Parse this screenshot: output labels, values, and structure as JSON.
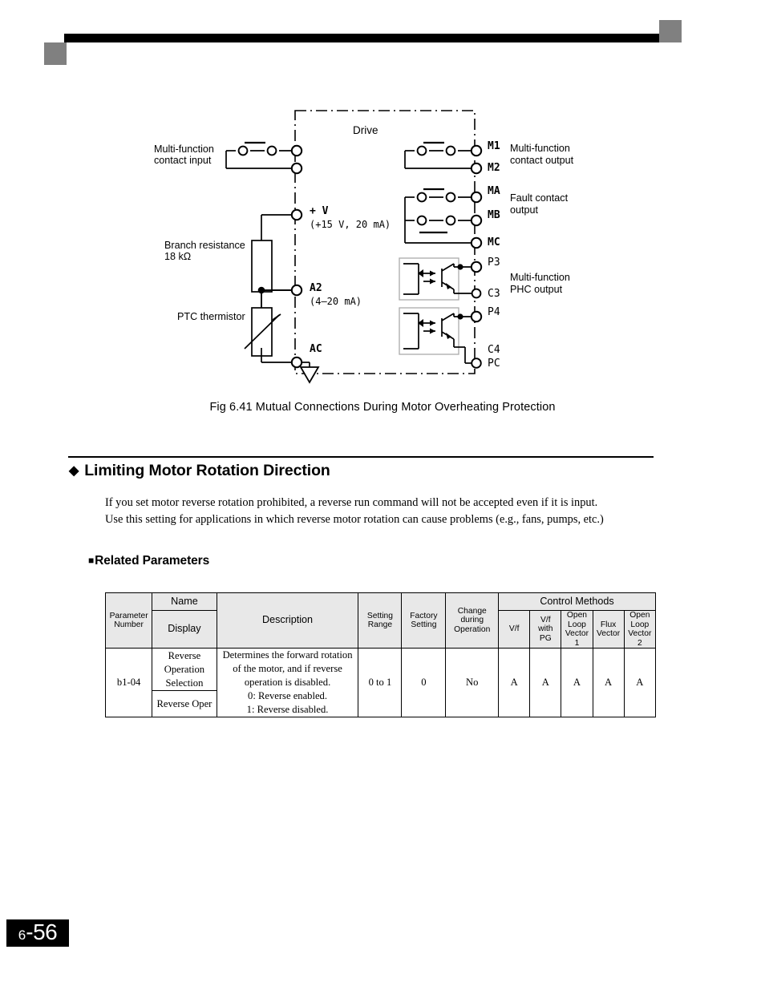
{
  "header": {
    "bar": "",
    "accent_color": "#808080"
  },
  "figure": {
    "caption": "Fig 6.41  Mutual Connections During Motor Overheating Protection",
    "drive_label": "Drive",
    "left_labels": {
      "multi_function_contact_input": "Multi-function\ncontact input",
      "multi_function_contact_input_l1": "Multi-function",
      "multi_function_contact_input_l2": "contact input",
      "branch_resistance_l1": "Branch resistance",
      "branch_resistance_l2": "18 kΩ",
      "ptc_thermistor": "PTC thermistor"
    },
    "terminals": {
      "plus_v": "+ V",
      "plus_v_spec": "(+15 V,  20 mA)",
      "a2": "A2",
      "a2_spec": "(4–20  mA)",
      "ac": "AC",
      "m1": "M1",
      "m2": "M2",
      "ma": "MA",
      "mb": "MB",
      "mc": "MC",
      "p3": "P3",
      "c3": "C3",
      "p4": "P4",
      "c4": "C4",
      "pc": "PC"
    },
    "right_labels": {
      "multi_function_contact_output_l1": "Multi-function",
      "multi_function_contact_output_l2": "contact output",
      "fault_contact_output_l1": "Fault   contact",
      "fault_contact_output_l2": "output",
      "multi_function_phc_output_l1": "Multi-function",
      "multi_function_phc_output_l2": "PHC output"
    }
  },
  "section": {
    "heading": "Limiting Motor Rotation Direction",
    "diamond_bullet": "◆",
    "paragraph_line1": "If you set motor reverse rotation prohibited, a reverse run command will not be accepted even if it is input.",
    "paragraph_line2": "Use this setting for applications in which reverse motor rotation can cause problems (e.g., fans, pumps, etc.)",
    "subheading": "Related Parameters",
    "square_bullet": "■"
  },
  "table": {
    "headers": {
      "parameter_number_l1": "Parameter",
      "parameter_number_l2": "Number",
      "name": "Name",
      "display": "Display",
      "description": "Description",
      "setting_range_l1": "Setting",
      "setting_range_l2": "Range",
      "factory_setting_l1": "Factory",
      "factory_setting_l2": "Setting",
      "change_during_operation_l1": "Change",
      "change_during_operation_l2": "during",
      "change_during_operation_l3": "Operation",
      "control_methods": "Control Methods",
      "vf": "V/f",
      "vf_with_pg_l1": "V/f",
      "vf_with_pg_l2": "with",
      "vf_with_pg_l3": "PG",
      "open_loop_vector_1_l1": "Open",
      "open_loop_vector_1_l2": "Loop",
      "open_loop_vector_1_l3": "Vector",
      "open_loop_vector_1_l4": "1",
      "flux_vector_l1": "Flux",
      "flux_vector_l2": "Vector",
      "open_loop_vector_2_l1": "Open",
      "open_loop_vector_2_l2": "Loop",
      "open_loop_vector_2_l3": "Vector",
      "open_loop_vector_2_l4": "2"
    },
    "rows": [
      {
        "parameter_number": "b1-04",
        "name_l1": "Reverse",
        "name_l2": "Operation",
        "name_l3": "Selection",
        "display": "Reverse Oper",
        "description_l1": "Determines the forward rotation",
        "description_l2": "of the motor, and if reverse",
        "description_l3": "operation is disabled.",
        "description_l4": "0: Reverse enabled.",
        "description_l5": "1: Reverse disabled.",
        "setting_range": "0 to 1",
        "factory_setting": "0",
        "change_during_operation": "No",
        "vf": "A",
        "vf_with_pg": "A",
        "open_loop_vector_1": "A",
        "flux_vector": "A",
        "open_loop_vector_2": "A"
      }
    ]
  },
  "footer": {
    "page_prefix": "6",
    "page_number": "-56"
  }
}
